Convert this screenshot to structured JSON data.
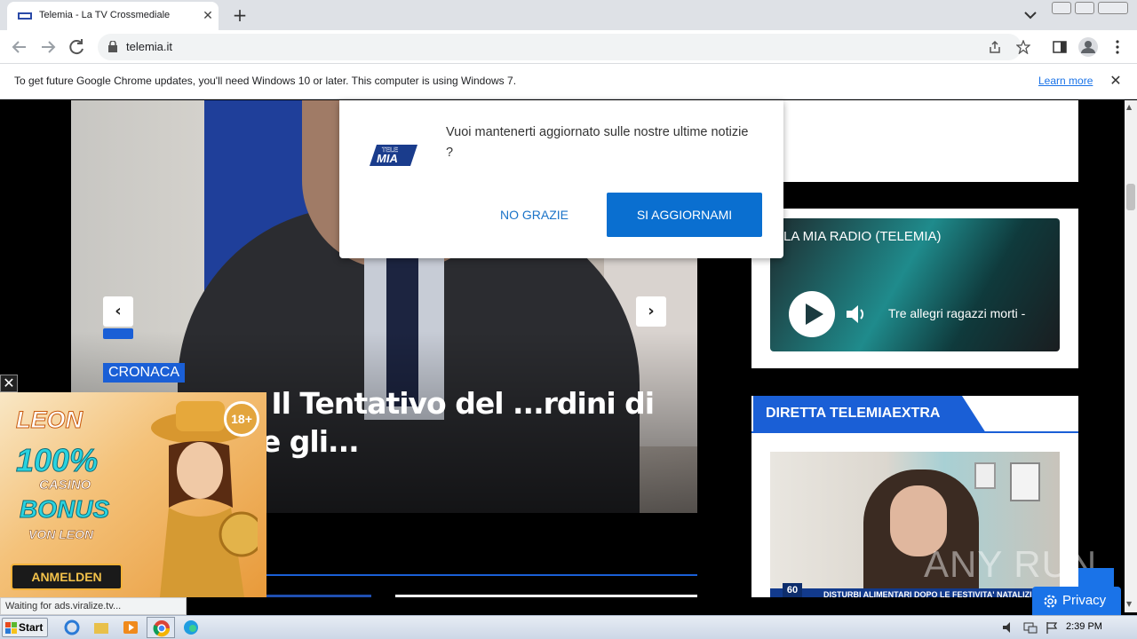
{
  "browser": {
    "tab_title": "Telemia - La TV Crossmediale",
    "url": "telemia.it",
    "infobar_text": "To get future Google Chrome updates, you'll need Windows 10 or later. This computer is using Windows 7.",
    "learn_more": "Learn more",
    "status_text": "Waiting for ads.viralize.tv..."
  },
  "popup": {
    "message": "Vuoi mantenerti aggiornato sulle nostre ultime notizie ?",
    "logo_text": "TELE MIA",
    "no_button": "NO GRAZIE",
    "yes_button": "SI AGGIORNAMI"
  },
  "hero": {
    "category": "CRONACA",
    "headline": "...ontorte: Il Tentativo del ...rdini di giustificare gli..."
  },
  "radio": {
    "title": "LA MIA RADIO (TELEMIA)",
    "track": "Tre allegri ragazzi morti -"
  },
  "live": {
    "title": "DIRETTA TELEMIAEXTRA",
    "ticker": "DISTURBI ALIMENTARI DOPO LE FESTIVITA' NATALIZIE",
    "badge": "60"
  },
  "ad": {
    "brand": "LEON",
    "percent": "100%",
    "casino": "CASINO",
    "bonus": "BONUS",
    "von": "VON LEON",
    "cta": "ANMELDEN",
    "age": "18+"
  },
  "privacy": {
    "label": "Privacy"
  },
  "watermark": "ANY RUN",
  "taskbar": {
    "start": "Start",
    "clock": "2:39 PM"
  },
  "colors": {
    "accent": "#1a5fd6",
    "chrome_link": "#1a73e8",
    "popup_button": "#0a6fd0"
  }
}
